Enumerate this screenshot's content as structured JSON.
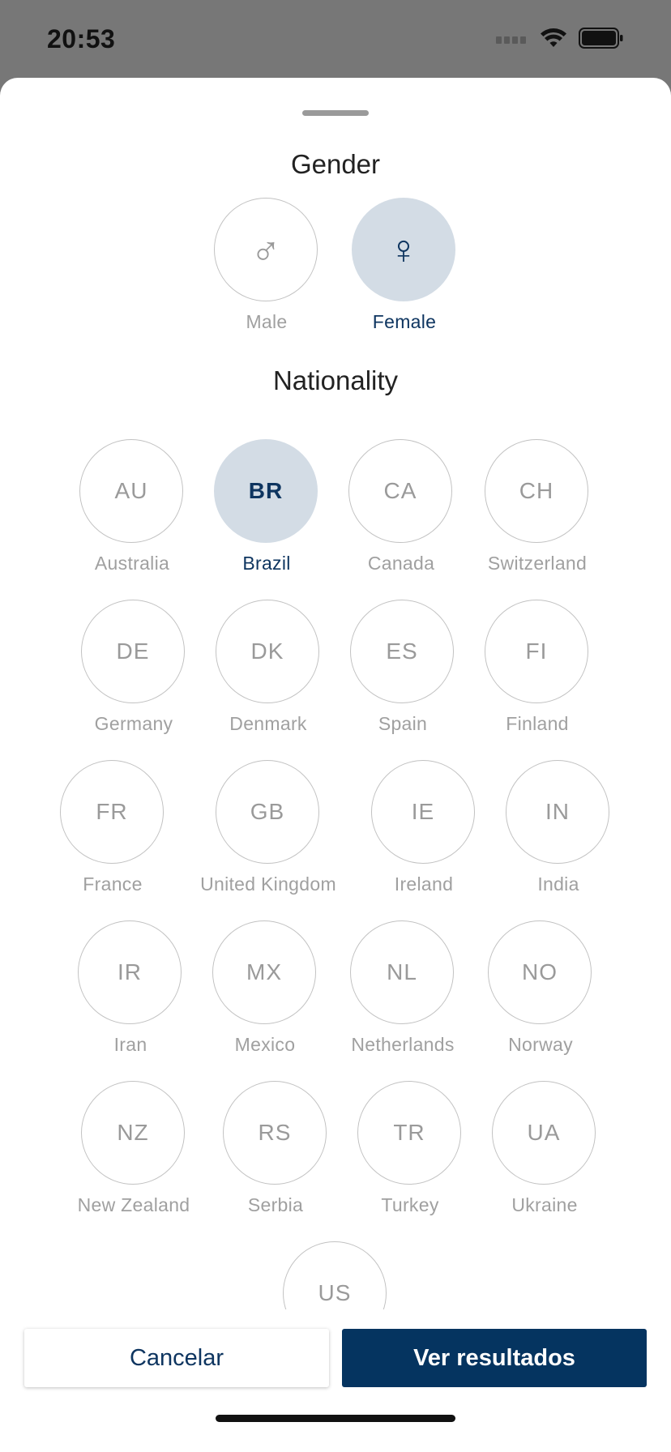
{
  "status_bar": {
    "time": "20:53"
  },
  "gender": {
    "title": "Gender",
    "options": [
      {
        "label": "Male",
        "icon": "male-symbol-icon",
        "glyph": "♂",
        "selected": false
      },
      {
        "label": "Female",
        "icon": "female-symbol-icon",
        "glyph": "♀",
        "selected": true
      }
    ]
  },
  "nationality": {
    "title": "Nationality",
    "options": [
      {
        "code": "AU",
        "label": "Australia",
        "selected": false
      },
      {
        "code": "BR",
        "label": "Brazil",
        "selected": true
      },
      {
        "code": "CA",
        "label": "Canada",
        "selected": false
      },
      {
        "code": "CH",
        "label": "Switzerland",
        "selected": false
      },
      {
        "code": "DE",
        "label": "Germany",
        "selected": false
      },
      {
        "code": "DK",
        "label": "Denmark",
        "selected": false
      },
      {
        "code": "ES",
        "label": "Spain",
        "selected": false
      },
      {
        "code": "FI",
        "label": "Finland",
        "selected": false
      },
      {
        "code": "FR",
        "label": "France",
        "selected": false
      },
      {
        "code": "GB",
        "label": "United Kingdom",
        "selected": false
      },
      {
        "code": "IE",
        "label": "Ireland",
        "selected": false
      },
      {
        "code": "IN",
        "label": "India",
        "selected": false
      },
      {
        "code": "IR",
        "label": "Iran",
        "selected": false
      },
      {
        "code": "MX",
        "label": "Mexico",
        "selected": false
      },
      {
        "code": "NL",
        "label": "Netherlands",
        "selected": false
      },
      {
        "code": "NO",
        "label": "Norway",
        "selected": false
      },
      {
        "code": "NZ",
        "label": "New Zealand",
        "selected": false
      },
      {
        "code": "RS",
        "label": "Serbia",
        "selected": false
      },
      {
        "code": "TR",
        "label": "Turkey",
        "selected": false
      },
      {
        "code": "UA",
        "label": "Ukraine",
        "selected": false
      },
      {
        "code": "US",
        "label": "",
        "selected": false
      }
    ]
  },
  "actions": {
    "cancel_label": "Cancelar",
    "results_label": "Ver resultados"
  },
  "colors": {
    "accent": "#053460",
    "selected_bg": "#d3dce5",
    "unselected_text": "#9a9a9a"
  }
}
